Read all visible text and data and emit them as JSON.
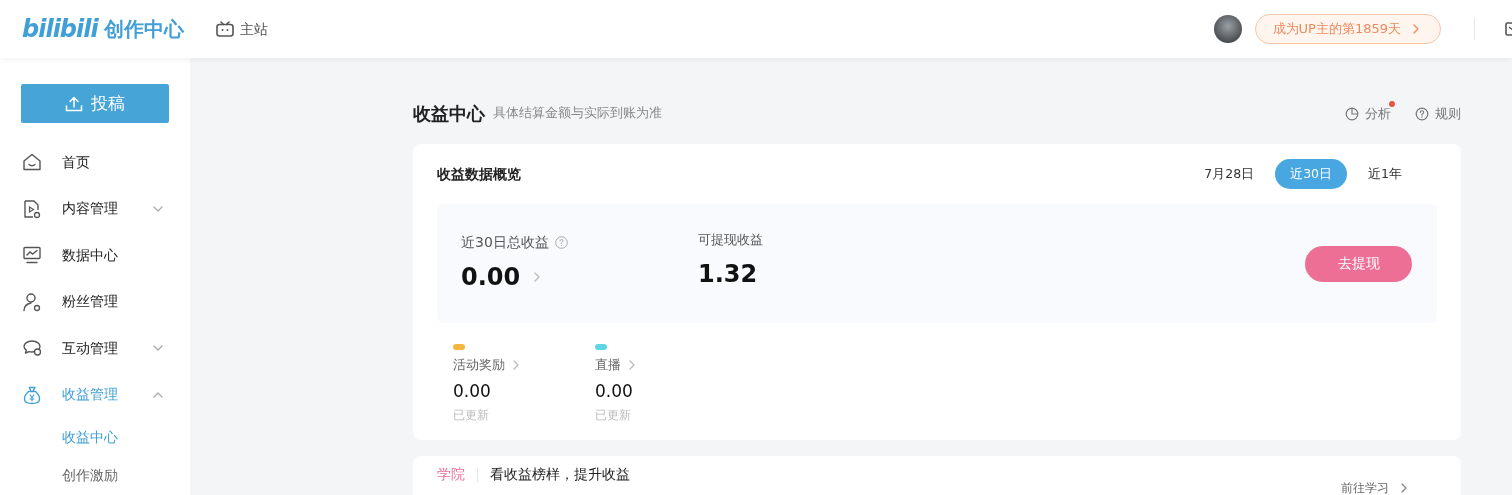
{
  "header": {
    "brand": "bilibili",
    "product": "创作中心",
    "main_site": "主站",
    "badge": "成为UP主的第1859天"
  },
  "sidebar": {
    "upload_button": "投稿",
    "items": [
      {
        "label": "首页",
        "kind": "link",
        "selected": false
      },
      {
        "label": "内容管理",
        "kind": "group",
        "expanded": false,
        "selected": false
      },
      {
        "label": "数据中心",
        "kind": "link",
        "selected": false
      },
      {
        "label": "粉丝管理",
        "kind": "link",
        "selected": false
      },
      {
        "label": "互动管理",
        "kind": "group",
        "expanded": false,
        "selected": false
      },
      {
        "label": "收益管理",
        "kind": "group",
        "expanded": true,
        "selected": true,
        "children": [
          {
            "label": "收益中心",
            "selected": true
          },
          {
            "label": "创作激励",
            "selected": false
          }
        ]
      }
    ]
  },
  "page": {
    "title": "收益中心",
    "subtitle": "具体结算金额与实际到账为准",
    "actions": [
      {
        "label": "分析",
        "dot": true
      },
      {
        "label": "规则",
        "dot": false
      }
    ]
  },
  "overview": {
    "title": "收益数据概览",
    "tabs": [
      {
        "label": "7月28日",
        "selected": false
      },
      {
        "label": "近30日",
        "selected": true
      },
      {
        "label": "近1年",
        "selected": false
      }
    ],
    "total": {
      "label": "近30日总收益",
      "value": "0.00"
    },
    "withdrawable": {
      "label": "可提现收益",
      "value": "1.32"
    },
    "withdraw_button": "去提现",
    "sources": [
      {
        "label": "活动奖励",
        "value": "0.00",
        "status": "已更新",
        "color": "#f4b63f"
      },
      {
        "label": "直播",
        "value": "0.00",
        "status": "已更新",
        "color": "#5fd6e4"
      }
    ]
  },
  "academy": {
    "tag": "学院",
    "text": "看收益榜样，提升收益",
    "link": "前往学习"
  }
}
